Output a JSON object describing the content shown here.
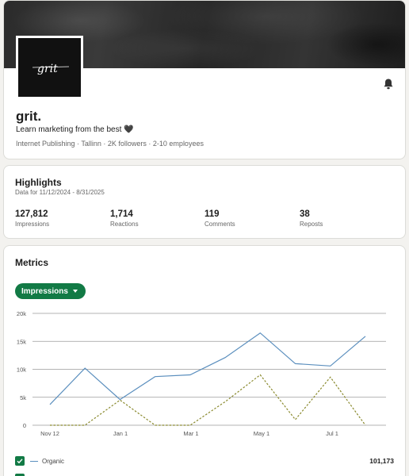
{
  "company": {
    "name": "grit.",
    "logo_text": "grit",
    "tagline": "Learn marketing from the best 🖤",
    "meta": "Internet Publishing · Tallinn · 2K followers · 2-10 employees",
    "bell_icon": "bell-icon"
  },
  "highlights": {
    "title": "Highlights",
    "range": "Data for 11/12/2024 - 8/31/2025",
    "stats": [
      {
        "value": "127,812",
        "label": "Impressions"
      },
      {
        "value": "1,714",
        "label": "Reactions"
      },
      {
        "value": "119",
        "label": "Comments"
      },
      {
        "value": "38",
        "label": "Reposts"
      }
    ]
  },
  "metrics": {
    "title": "Metrics",
    "dropdown_label": "Impressions",
    "legend": [
      {
        "label": "Organic",
        "total": "101,173",
        "checked": true
      }
    ]
  },
  "colors": {
    "accent": "#127a45",
    "organic": "#5b8fbe",
    "sponsored": "#8a8a2e"
  },
  "chart_data": {
    "type": "line",
    "y_ticks": [
      "0",
      "5k",
      "10k",
      "15k",
      "20k"
    ],
    "ylim": [
      0,
      20000
    ],
    "x_ticks": [
      "Nov 12",
      "Jan 1",
      "Mar 1",
      "May 1",
      "Jul 1"
    ],
    "series": [
      {
        "name": "Organic",
        "style": "solid",
        "values": [
          3700,
          10200,
          4600,
          8700,
          9000,
          12100,
          16500,
          11000,
          10600,
          15900
        ]
      },
      {
        "style": "dashed",
        "values": [
          0,
          0,
          4500,
          0,
          0,
          4200,
          9000,
          1000,
          8600,
          0
        ]
      }
    ]
  }
}
